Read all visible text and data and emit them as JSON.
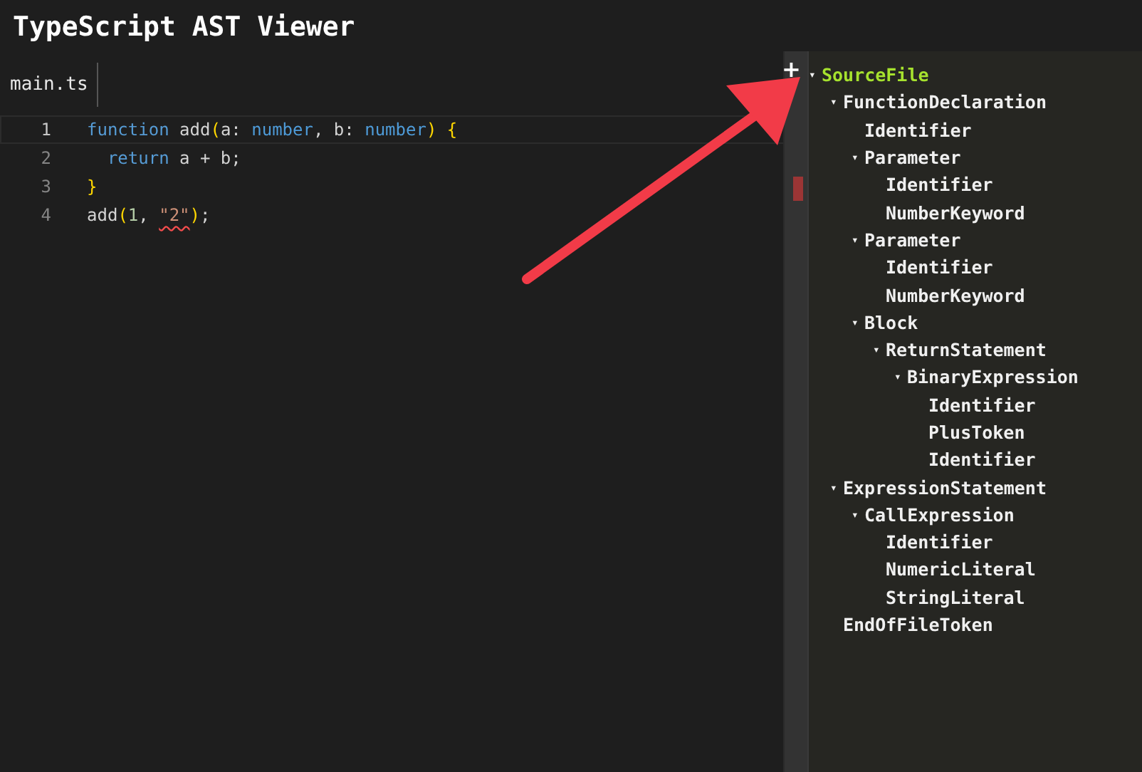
{
  "title": "TypeScript AST Viewer",
  "tabs": [
    {
      "label": "main.ts",
      "selected": true
    }
  ],
  "add_button": "+",
  "code_lines": [
    {
      "number": "1",
      "current": true,
      "tokens": [
        {
          "kind": "keyword",
          "text": "function"
        },
        {
          "kind": "plain",
          "text": " add"
        },
        {
          "kind": "bracket",
          "text": "("
        },
        {
          "kind": "plain",
          "text": "a: "
        },
        {
          "kind": "type",
          "text": "number"
        },
        {
          "kind": "plain",
          "text": ", b: "
        },
        {
          "kind": "type",
          "text": "number"
        },
        {
          "kind": "bracket",
          "text": ")"
        },
        {
          "kind": "bracket",
          "text": " {"
        }
      ]
    },
    {
      "number": "2",
      "current": false,
      "tokens": [
        {
          "kind": "keyword",
          "text": "  return"
        },
        {
          "kind": "plain",
          "text": " a + b;"
        }
      ]
    },
    {
      "number": "3",
      "current": false,
      "tokens": [
        {
          "kind": "bracket",
          "text": "}"
        }
      ]
    },
    {
      "number": "4",
      "current": false,
      "tokens": [
        {
          "kind": "plain",
          "text": "add"
        },
        {
          "kind": "bracket",
          "text": "("
        },
        {
          "kind": "number",
          "text": "1"
        },
        {
          "kind": "plain",
          "text": ", "
        },
        {
          "kind": "string",
          "text": "\"2\"",
          "error": true
        },
        {
          "kind": "bracket",
          "text": ")"
        },
        {
          "kind": "plain",
          "text": ";"
        }
      ]
    }
  ],
  "tree": [
    {
      "label": "SourceFile",
      "selected": true,
      "expanded": true,
      "toggle": "▾",
      "children": [
        {
          "label": "FunctionDeclaration",
          "selected": false,
          "expanded": true,
          "toggle": "▾",
          "children": [
            {
              "label": "Identifier",
              "selected": false,
              "expanded": false
            },
            {
              "label": "Parameter",
              "selected": false,
              "expanded": true,
              "toggle": "▾",
              "children": [
                {
                  "label": "Identifier",
                  "selected": false,
                  "expanded": false
                },
                {
                  "label": "NumberKeyword",
                  "selected": false,
                  "expanded": false
                }
              ]
            },
            {
              "label": "Parameter",
              "selected": false,
              "expanded": true,
              "toggle": "▾",
              "children": [
                {
                  "label": "Identifier",
                  "selected": false,
                  "expanded": false
                },
                {
                  "label": "NumberKeyword",
                  "selected": false,
                  "expanded": false
                }
              ]
            },
            {
              "label": "Block",
              "selected": false,
              "expanded": true,
              "toggle": "▾",
              "children": [
                {
                  "label": "ReturnStatement",
                  "selected": false,
                  "expanded": true,
                  "toggle": "▾",
                  "children": [
                    {
                      "label": "BinaryExpression",
                      "selected": false,
                      "expanded": true,
                      "toggle": "▾",
                      "children": [
                        {
                          "label": "Identifier",
                          "selected": false,
                          "expanded": false
                        },
                        {
                          "label": "PlusToken",
                          "selected": false,
                          "expanded": false
                        },
                        {
                          "label": "Identifier",
                          "selected": false,
                          "expanded": false
                        }
                      ]
                    }
                  ]
                }
              ]
            }
          ]
        },
        {
          "label": "ExpressionStatement",
          "selected": false,
          "expanded": true,
          "toggle": "▾",
          "children": [
            {
              "label": "CallExpression",
              "selected": false,
              "expanded": true,
              "toggle": "▾",
              "children": [
                {
                  "label": "Identifier",
                  "selected": false,
                  "expanded": false
                },
                {
                  "label": "NumericLiteral",
                  "selected": false,
                  "expanded": false
                },
                {
                  "label": "StringLiteral",
                  "selected": false,
                  "expanded": false
                }
              ]
            }
          ]
        },
        {
          "label": "EndOfFileToken",
          "selected": false,
          "expanded": false
        }
      ]
    }
  ]
}
